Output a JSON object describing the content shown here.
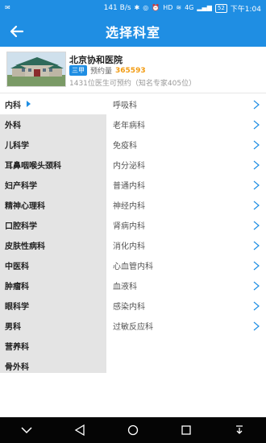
{
  "status_bar": {
    "speed": "141 B/s",
    "signal": "4G",
    "battery": "52",
    "time": "下午1:04"
  },
  "header": {
    "title": "选择科室"
  },
  "hospital": {
    "name": "北京协和医院",
    "level": "三甲",
    "appointment_label": "预约量",
    "appointment_count": "365593",
    "sub_text": "1431位医生可预约（知名专家405位）"
  },
  "departments": [
    {
      "label": "内科",
      "active": true
    },
    {
      "label": "外科"
    },
    {
      "label": "儿科学"
    },
    {
      "label": "耳鼻咽喉头颈科"
    },
    {
      "label": "妇产科学"
    },
    {
      "label": "精神心理科"
    },
    {
      "label": "口腔科学"
    },
    {
      "label": "皮肤性病科"
    },
    {
      "label": "中医科"
    },
    {
      "label": "肿瘤科"
    },
    {
      "label": "眼科学"
    },
    {
      "label": "男科"
    },
    {
      "label": "营养科"
    },
    {
      "label": "骨外科"
    }
  ],
  "sub_departments": [
    {
      "label": "呼吸科"
    },
    {
      "label": "老年病科"
    },
    {
      "label": "免疫科"
    },
    {
      "label": "内分泌科"
    },
    {
      "label": "普通内科"
    },
    {
      "label": "神经内科"
    },
    {
      "label": "肾病内科"
    },
    {
      "label": "消化内科"
    },
    {
      "label": "心血管内科"
    },
    {
      "label": "血液科"
    },
    {
      "label": "感染内科"
    },
    {
      "label": "过敏反应科"
    }
  ],
  "colors": {
    "primary": "#1f8ee3",
    "accent": "#f29b11",
    "sidebar_bg": "#e4e4e4",
    "nav_bg": "#050505"
  }
}
